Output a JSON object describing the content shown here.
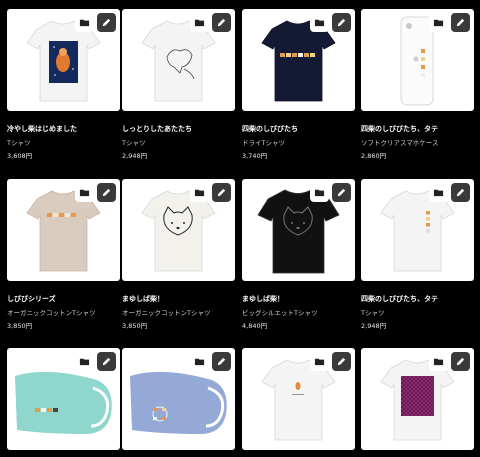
{
  "products": [
    {
      "title": "冷やし柴はじめました",
      "type": "Tシャツ",
      "price": "3,608円",
      "image": "white-tshirt-navy-panel"
    },
    {
      "title": "しっとりしたあたたち",
      "type": "Tシャツ",
      "price": "2,948円",
      "image": "white-tshirt-lineart"
    },
    {
      "title": "四柴のしびびたち",
      "type": "ドライTシャツ",
      "price": "3,740円",
      "image": "navy-tshirt-row"
    },
    {
      "title": "四柴のしびびたち、タテ",
      "type": "ソフトクリアスマホケース",
      "price": "2,860円",
      "image": "phone-case"
    },
    {
      "title": "しびびシリーズ",
      "type": "オーガニックコットンTシャツ",
      "price": "3,850円",
      "image": "beige-tshirt"
    },
    {
      "title": "まゆしば柴！",
      "type": "オーガニックコットンTシャツ",
      "price": "3,850円",
      "image": "white-tshirt-face"
    },
    {
      "title": "まゆしば柴！",
      "type": "ビッグシルエットTシャツ",
      "price": "4,840円",
      "image": "black-tshirt-face"
    },
    {
      "title": "四柴のしびびたち、タテ",
      "type": "Tシャツ",
      "price": "2,948円",
      "image": "white-tshirt-vertical"
    },
    {
      "title": "",
      "type": "",
      "price": "",
      "image": "mint-mask"
    },
    {
      "title": "",
      "type": "",
      "price": "",
      "image": "blue-mask"
    },
    {
      "title": "",
      "type": "",
      "price": "",
      "image": "white-tshirt-small"
    },
    {
      "title": "",
      "type": "",
      "price": "",
      "image": "white-tshirt-purple"
    }
  ],
  "icons": {
    "folder": "folder-icon",
    "edit": "pencil-icon"
  },
  "colors": {
    "background": "#000000",
    "card": "#ffffff",
    "edit_button": "#3a3a3a"
  }
}
